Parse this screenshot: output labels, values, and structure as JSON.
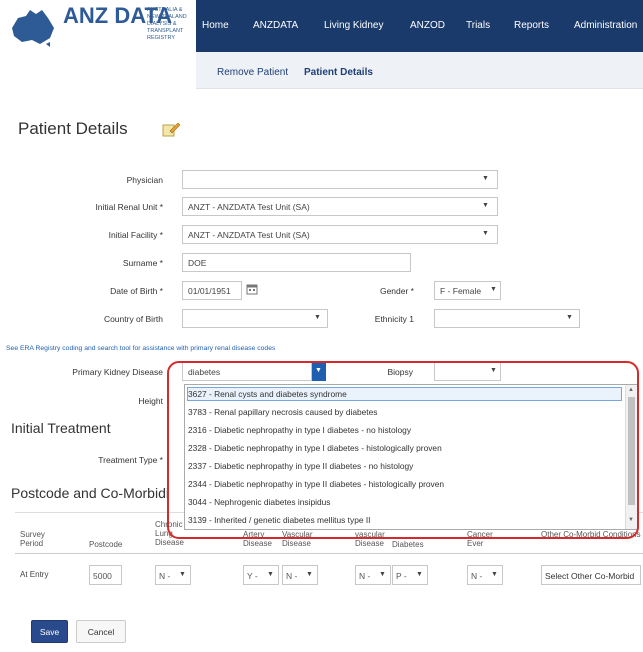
{
  "header": {
    "logo_text": "ANZ DATA",
    "logo_caption": "AUSTRALIA & NEW ZEALAND DIALYSIS & TRANSPLANT REGISTRY",
    "nav": [
      "Home",
      "ANZDATA",
      "Living Kidney",
      "ANZOD",
      "Trials",
      "Reports",
      "Administration"
    ],
    "subnav": [
      "Remove Patient",
      "Patient Details"
    ],
    "colors": {
      "nav_bg": "#1a3a6b",
      "accent": "#1f5fb0",
      "highlight_border": "#d62a2a"
    }
  },
  "page": {
    "title": "Patient Details",
    "edit_icon": "edit-note-icon"
  },
  "form": {
    "physician": {
      "label": "Physician",
      "value": ""
    },
    "initial_renal_unit": {
      "label": "Initial Renal Unit *",
      "value": "ANZT - ANZDATA Test Unit (SA)"
    },
    "initial_facility": {
      "label": "Initial Facility *",
      "value": "ANZT - ANZDATA Test Unit (SA)"
    },
    "surname": {
      "label": "Surname *",
      "value": "DOE"
    },
    "dob": {
      "label": "Date of Birth *",
      "value": "01/01/1951"
    },
    "gender": {
      "label": "Gender *",
      "value": "F - Female"
    },
    "country_of_birth": {
      "label": "Country of Birth",
      "value": ""
    },
    "ethnicity": {
      "label": "Ethnicity 1",
      "value": ""
    },
    "era_link": "See ERA Registry coding and search tool for assistance with primary renal disease codes",
    "primary_kidney_disease": {
      "label": "Primary Kidney Disease",
      "value": "diabetes"
    },
    "biopsy": {
      "label": "Biopsy",
      "value": ""
    },
    "height": {
      "label": "Height"
    }
  },
  "dropdown": {
    "options": [
      "3627 - Renal cysts and diabetes syndrome",
      "3783 - Renal papillary necrosis caused by diabetes",
      "2316 - Diabetic nephropathy in type I diabetes - no histology",
      "2328 - Diabetic nephropathy in type I diabetes - histologically proven",
      "2337 - Diabetic nephropathy in type II diabetes - no histology",
      "2344 - Diabetic nephropathy in type II diabetes - histologically proven",
      "3044 - Nephrogenic diabetes insipidus",
      "3139 - Inherited / genetic diabetes mellitus type II"
    ]
  },
  "sections": {
    "initial_treatment": "Initial Treatment",
    "treatment_type_label": "Treatment Type *",
    "postcode_section": "Postcode and Co-Morbidi"
  },
  "table": {
    "headers": {
      "survey_period": "Survey Period",
      "postcode": "Postcode",
      "chronic_lung": "Chronic Lung Disease",
      "artery": "Artery Disease",
      "vascular": "Vascular Disease",
      "vascular2": "vascular Disease",
      "diabetes": "Diabetes",
      "cancer": "Cancer Ever",
      "other": "Other Co-Morbid Conditions"
    },
    "row": {
      "period": "At Entry",
      "postcode": "5000",
      "chronic_lung": "N -",
      "artery": "Y -",
      "vascular": "N -",
      "vascular2": "N -",
      "diabetes": "P -",
      "cancer": "N -",
      "other": "Select Other Co-Morbid"
    }
  },
  "buttons": {
    "save": "Save",
    "cancel": "Cancel"
  }
}
